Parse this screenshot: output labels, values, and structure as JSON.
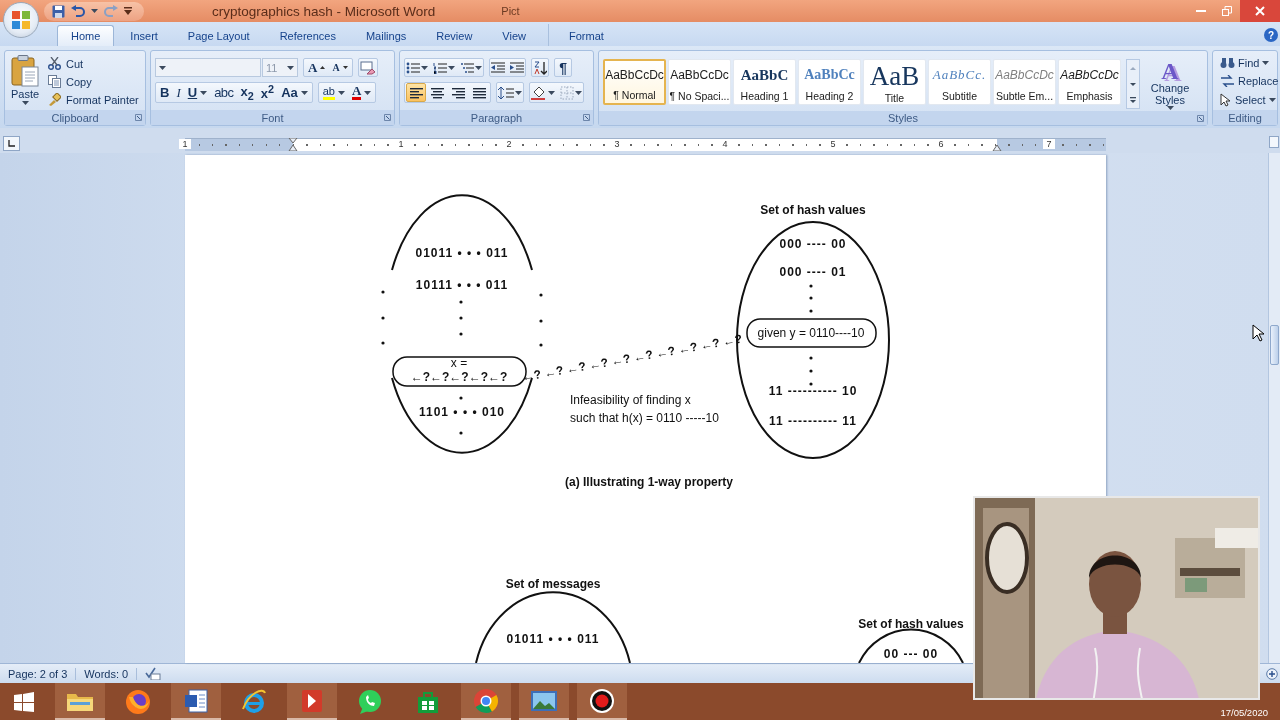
{
  "window": {
    "title": "cryptographics hash - Microsoft Word",
    "contextual_group": "Pict",
    "help": "?"
  },
  "ribbon_tabs": [
    {
      "label": "Home",
      "selected": true
    },
    {
      "label": "Insert",
      "selected": false
    },
    {
      "label": "Page Layout",
      "selected": false
    },
    {
      "label": "References",
      "selected": false
    },
    {
      "label": "Mailings",
      "selected": false
    },
    {
      "label": "Review",
      "selected": false
    },
    {
      "label": "View",
      "selected": false
    },
    {
      "label": "Format",
      "selected": false
    }
  ],
  "clipboard": {
    "paste": "Paste",
    "commands": [
      "Cut",
      "Copy",
      "Format Painter"
    ],
    "group_label": "Clipboard"
  },
  "font": {
    "size": "11",
    "grow": "A",
    "shrink": "A",
    "format_buttons": [
      {
        "kind": "bold",
        "label": "B"
      },
      {
        "kind": "italic",
        "label": "I"
      },
      {
        "kind": "underline",
        "label": "U"
      },
      {
        "kind": "strike",
        "label": "abc"
      },
      {
        "kind": "subscript",
        "label": "x$_{2}$"
      },
      {
        "kind": "superscript",
        "label": "x$^{2}$"
      },
      {
        "kind": "case",
        "label": "Aa"
      }
    ],
    "highlight": "ab",
    "font_color": "A",
    "group_label": "Font"
  },
  "paragraph": {
    "show_marks": "¶",
    "alignments": [
      {
        "kind": "left",
        "selected": true
      },
      {
        "kind": "center",
        "selected": false
      },
      {
        "kind": "right",
        "selected": false
      },
      {
        "kind": "justify",
        "selected": false
      }
    ],
    "group_label": "Paragraph"
  },
  "styles": {
    "gallery": [
      {
        "kind": "normal",
        "preview": "AaBbCcDc",
        "label": "¶ Normal",
        "selected": true
      },
      {
        "kind": "normal",
        "preview": "AaBbCcDc",
        "label": "¶ No Spaci...",
        "selected": false
      },
      {
        "kind": "heading1",
        "preview": "AaBbC",
        "label": "Heading 1",
        "selected": false
      },
      {
        "kind": "heading2",
        "preview": "AaBbCc",
        "label": "Heading 2",
        "selected": false
      },
      {
        "kind": "title",
        "preview": "AaB",
        "label": "Title",
        "selected": false
      },
      {
        "kind": "subtitle",
        "preview": "AaBbCc.",
        "label": "Subtitle",
        "selected": false
      },
      {
        "kind": "subtle",
        "preview": "AaBbCcDc",
        "label": "Subtle Em...",
        "selected": false
      },
      {
        "kind": "emphasis",
        "preview": "AaBbCcDc",
        "label": "Emphasis",
        "selected": false
      }
    ],
    "change_styles_mark": "A",
    "change_styles": "Change Styles",
    "group_label": "Styles"
  },
  "editing": {
    "commands": [
      "Find",
      "Replace",
      "Select"
    ],
    "group_label": "Editing"
  },
  "ruler": {
    "numbers": [
      "1",
      "1",
      "2",
      "3",
      "4",
      "5",
      "6",
      "7"
    ]
  },
  "diagram_a": {
    "messages": [
      "01011 • • • 011",
      "10111 • • • 011",
      "1101 • • • 010"
    ],
    "x_label": "x =",
    "x_trail": "←?←?←?←?←?",
    "search_trail": "←? ←? ←? ←? ←? ←? ←? ←? ←? ←?",
    "hash_set_title": "Set of hash values",
    "hash_values": [
      "000 ---- 00",
      "000 ---- 01",
      "11 ---------- 10",
      "11 ---------- 11"
    ],
    "given": "given y = 0110----10",
    "note": [
      "Infeasibility of finding x",
      "such that h(x) = 0110 -----10"
    ],
    "caption": "(a) Illustrating 1-way property"
  },
  "diagram_b": {
    "messages_title": "Set of messages",
    "messages": [
      "01011 • • • 011"
    ],
    "hash_set_title": "Set of hash values",
    "hash_values": [
      "00 --- 00"
    ]
  },
  "status_bar": {
    "page": "Page: 2 of 3",
    "words": "Words: 0"
  },
  "taskbar": {
    "apps": [
      {
        "kind": "folder",
        "running": true
      },
      {
        "kind": "firefox",
        "running": false
      },
      {
        "kind": "word",
        "running": true
      },
      {
        "kind": "ie",
        "running": false
      },
      {
        "kind": "reader",
        "running": true
      },
      {
        "kind": "chat",
        "running": false
      },
      {
        "kind": "store",
        "running": false
      },
      {
        "kind": "chrome",
        "running": true
      },
      {
        "kind": "photos",
        "running": true
      },
      {
        "kind": "recorder",
        "running": true
      }
    ],
    "date": "17/05/2020"
  }
}
